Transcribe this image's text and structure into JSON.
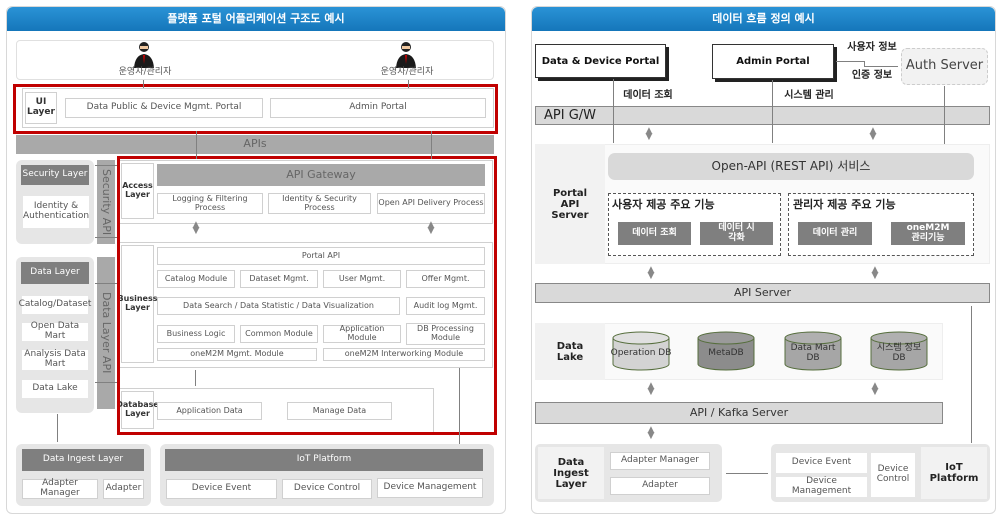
{
  "left": {
    "title": "플랫폼 포털 어플리케이션 구조도 예시",
    "users": [
      "운영자/관리자",
      "운영자/관리자"
    ],
    "ui_layer": {
      "label": "UI Layer",
      "items": [
        "Data Public & Device Mgmt. Portal",
        "Admin Portal"
      ]
    },
    "apis_label": "APIs",
    "security_layer": {
      "label": "Security Layer",
      "items": [
        "Identity & Authentication"
      ],
      "api_label": "Security API"
    },
    "data_layer": {
      "label": "Data Layer",
      "items": [
        "Catalog/Dataset",
        "Open Data Mart",
        "Analysis Data Mart",
        "Data Lake"
      ],
      "api_label": "Data Layer API"
    },
    "access_layer": {
      "label": "Access Layer",
      "gateway": "API Gateway",
      "items": [
        "Logging & Filtering Process",
        "Identity & Security Process",
        "Open API Delivery Process"
      ]
    },
    "business_layer": {
      "label": "Business Layer",
      "portal_api": "Portal API",
      "row1": [
        "Catalog Module",
        "Dataset Mgmt.",
        "User Mgmt.",
        "Offer Mgmt."
      ],
      "row2": [
        "Data Search / Data Statistic / Data Visualization",
        "Audit log Mgmt."
      ],
      "row3": [
        "Business Logic",
        "Common Module",
        "Application Module",
        "DB Processing Module"
      ],
      "row4": [
        "oneM2M Mgmt. Module",
        "oneM2M Interworking Module"
      ]
    },
    "database_layer": {
      "label": "Database Layer",
      "items": [
        "Application Data",
        "Manage Data"
      ]
    },
    "ingest_layer": {
      "label": "Data Ingest Layer",
      "items": [
        "Adapter Manager",
        "Adapter"
      ]
    },
    "iot_platform": {
      "label": "IoT Platform",
      "items": [
        "Device Event",
        "Device Control",
        "Device Management"
      ]
    }
  },
  "right": {
    "title": "데이터 흐름 정의 예시",
    "portals": [
      "Data & Device Portal",
      "Admin Portal"
    ],
    "auth_server": "Auth Server",
    "user_info": "사용자 정보",
    "auth_info": "인증 정보",
    "data_query": "데이터 조회",
    "system_mgmt": "시스템 관리",
    "api_gw": "API G/W",
    "portal_api_server": {
      "label": "Portal API Server",
      "open_api": "Open-API (REST API) 서비스",
      "user_group": {
        "title": "사용자 제공 주요 기능",
        "items": [
          "데이터 조회",
          "데이터 시각화"
        ]
      },
      "admin_group": {
        "title": "관리자 제공 주요 기능",
        "items": [
          "데이터 관리",
          "oneM2M 관리기능"
        ]
      }
    },
    "api_server": "API Server",
    "data_lake": {
      "label": "Data Lake",
      "dbs": [
        "Operation DB",
        "MetaDB",
        "Data Mart DB",
        "시스템 정보 DB"
      ]
    },
    "kafka_server": "API / Kafka Server",
    "ingest": {
      "label": "Data Ingest Layer",
      "items": [
        "Adapter Manager",
        "Adapter"
      ]
    },
    "iot": {
      "label": "IoT Platform",
      "items": [
        "Device Event",
        "Device Management",
        "Device Control"
      ]
    }
  },
  "colors": {
    "header_blue": "#1a82c8",
    "highlight_red": "#c00000",
    "dark_gray": "#7f7f7f",
    "mid_gray": "#a9a9a9"
  }
}
